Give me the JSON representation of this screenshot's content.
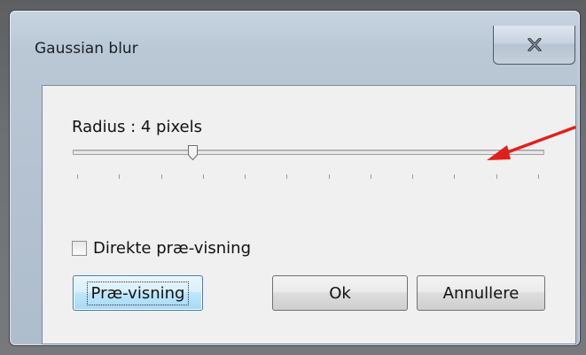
{
  "window": {
    "title": "Gaussian blur",
    "close_glyph": "X"
  },
  "radius": {
    "label": "Radius : 4 pixels",
    "value": 4,
    "min": 0,
    "max": 16,
    "tick_count": 12
  },
  "preview_checkbox": {
    "label": "Direkte præ-visning",
    "checked": false
  },
  "buttons": {
    "preview": "Præ-visning",
    "ok": "Ok",
    "cancel": "Annullere"
  },
  "colors": {
    "annotation_arrow": "#e0201b",
    "focus_button": "#bee6fd"
  },
  "icons": {
    "close": "close-icon",
    "annotation": "red-arrow-icon"
  }
}
